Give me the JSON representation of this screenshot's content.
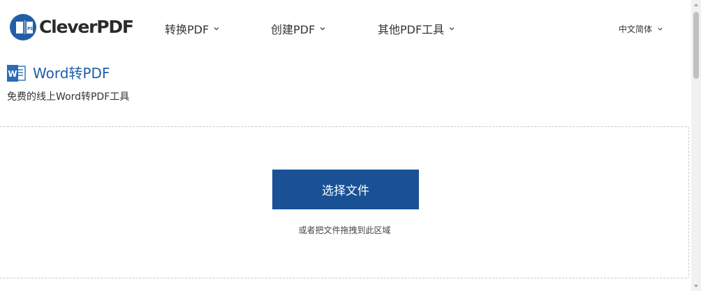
{
  "brand": {
    "name": "CleverPDF",
    "colors": {
      "logo_blue": "#1f5fa6",
      "accent": "#1a5195",
      "title_blue": "#1f5fa6"
    }
  },
  "nav": {
    "items": [
      {
        "label": "转换PDF",
        "icon": "chevron-down-icon"
      },
      {
        "label": "创建PDF",
        "icon": "chevron-down-icon"
      },
      {
        "label": "其他PDF工具",
        "icon": "chevron-down-icon"
      }
    ],
    "language": {
      "label": "中文简体",
      "icon": "chevron-down-icon"
    }
  },
  "tool": {
    "icon": "word-icon",
    "title": "Word转PDF",
    "subtitle": "免费的线上Word转PDF工具"
  },
  "upload": {
    "button_label": "选择文件",
    "hint": "或者把文件拖拽到此区域"
  }
}
